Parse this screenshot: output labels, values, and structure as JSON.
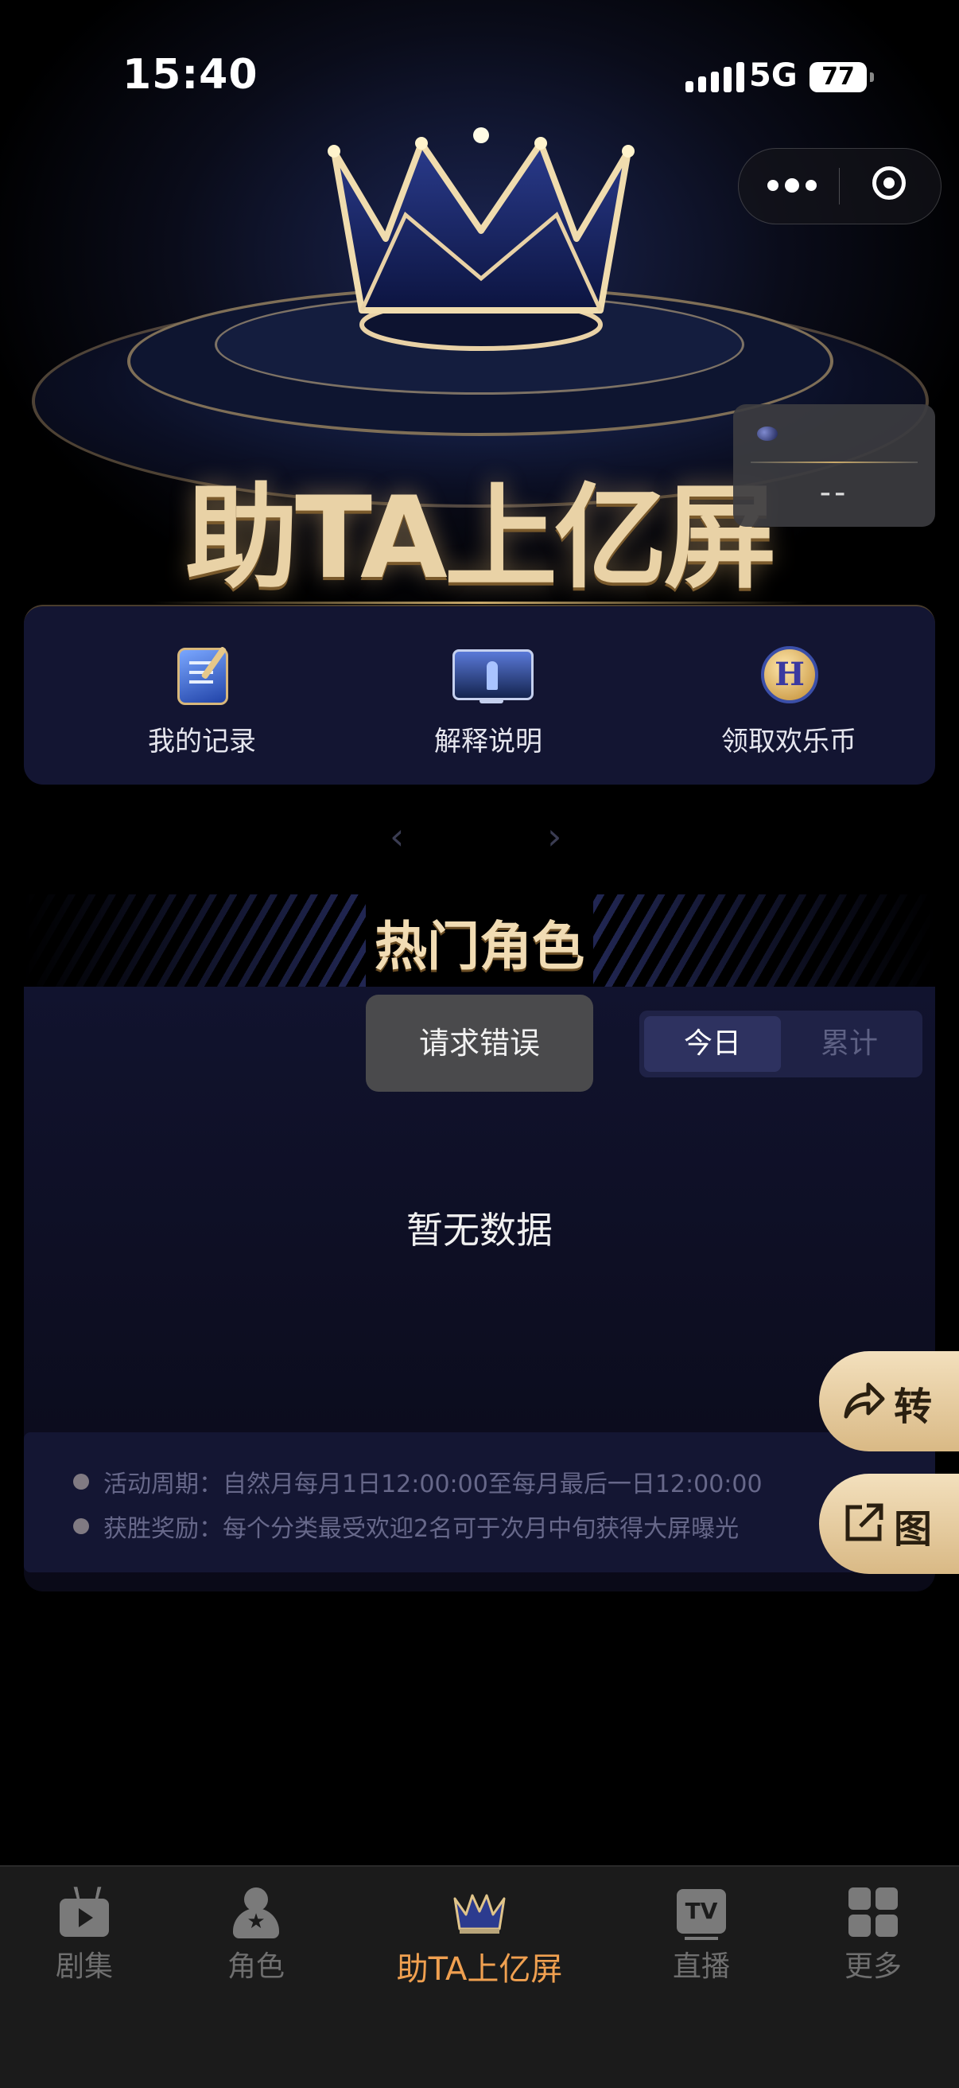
{
  "status_bar": {
    "time": "15:40",
    "network": "5G",
    "battery": "77"
  },
  "hero": {
    "title": "助TA上亿屏",
    "float_value": "--"
  },
  "quick_menu": [
    {
      "label": "我的记录",
      "icon": "record-icon"
    },
    {
      "label": "解释说明",
      "icon": "screen-icon"
    },
    {
      "label": "领取欢乐币",
      "icon": "coin-icon"
    }
  ],
  "pager": {
    "prev": "‹",
    "next": "›"
  },
  "hot_section": {
    "title": "热门角色",
    "toast": "请求错误",
    "segments": [
      "今日",
      "累计"
    ],
    "active_segment": "今日",
    "empty_text": "暂无数据",
    "rules": [
      "活动周期：自然月每月1日12:00:00至每月最后一日12:00:00",
      "获胜奖励：每个分类最受欢迎2名可于次月中旬获得大屏曝光"
    ]
  },
  "side_buttons": {
    "share": "转",
    "image": "图"
  },
  "tabs": [
    {
      "label": "剧集",
      "icon": "tv-icon"
    },
    {
      "label": "角色",
      "icon": "role-icon"
    },
    {
      "label": "助TA上亿屏",
      "icon": "crown-icon",
      "active": true
    },
    {
      "label": "直播",
      "icon": "live-tv-icon",
      "badge": "TV"
    },
    {
      "label": "更多",
      "icon": "grid-icon"
    }
  ],
  "colors": {
    "accent": "#f0a050",
    "gold": "#e9d2a6",
    "panel": "#131532"
  }
}
